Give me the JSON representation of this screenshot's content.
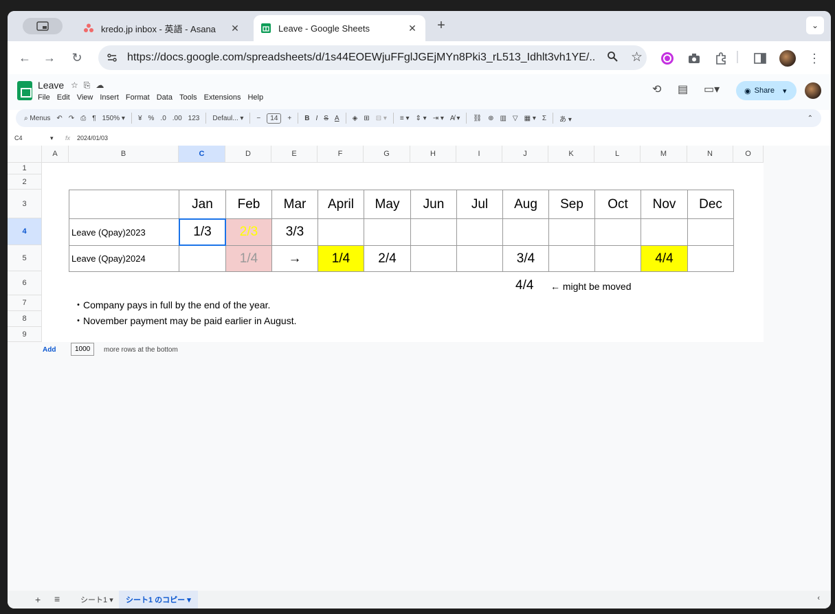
{
  "browser": {
    "tabs": [
      {
        "label": "kredo.jp inbox - 英語 - Asana",
        "close": "✕"
      },
      {
        "label": "Leave - Google Sheets",
        "close": "✕"
      }
    ],
    "new_tab": "+",
    "tab_menu": "⌄",
    "url": "https://docs.google.com/spreadsheets/d/1s44EOEWjuFFglJGEjMYn8Pki3_rL513_Idhlt3vh1YE/..."
  },
  "sheets": {
    "title": "Leave",
    "menu": [
      "File",
      "Edit",
      "View",
      "Insert",
      "Format",
      "Data",
      "Tools",
      "Extensions",
      "Help"
    ],
    "share_label": "Share",
    "toolbar": {
      "menus": "Menus",
      "zoom": "150%",
      "currency": "¥",
      "percent": "%",
      "dec_minus": ".0",
      "dec_plus": ".00",
      "number": "123",
      "font": "Defaul...",
      "minus": "−",
      "font_size": "14",
      "plus": "+",
      "bold": "B",
      "italic": "I",
      "strike": "S",
      "text_color": "A",
      "sum": "Σ",
      "input": "あ"
    },
    "name_box": "C4",
    "fx": "fx",
    "formula": "2024/01/03"
  },
  "grid": {
    "columns": [
      "A",
      "B",
      "C",
      "D",
      "E",
      "F",
      "G",
      "H",
      "I",
      "J",
      "K",
      "L",
      "M",
      "N",
      "O"
    ],
    "rows": [
      "1",
      "2",
      "3",
      "4",
      "5",
      "6",
      "7",
      "8",
      "9"
    ],
    "months": [
      "Jan",
      "Feb",
      "Mar",
      "April",
      "May",
      "Jun",
      "Jul",
      "Aug",
      "Sep",
      "Oct",
      "Nov",
      "Dec"
    ],
    "row4_label": "Leave (Qpay)2023",
    "row4": [
      "1/3",
      "2/3",
      "3/3",
      "",
      "",
      "",
      "",
      "",
      "",
      "",
      "",
      ""
    ],
    "row5_label": "Leave (Qpay)2024",
    "row5": [
      "",
      "1/4",
      "→",
      "1/4",
      "2/4",
      "",
      "",
      "3/4",
      "",
      "",
      "4/4",
      ""
    ],
    "row6_value": "4/4",
    "row6_note": "← might be moved",
    "note1": "・Company pays in full by the end of the year.",
    "note2": "・November payment may be paid earlier in August.",
    "add_label": "Add",
    "add_count": "1000",
    "add_suffix": "more rows at the bottom",
    "colors": {
      "yellow": "#ffff00",
      "pink": "#f4cccc",
      "selected_border": "#1a73e8"
    }
  },
  "bottom": {
    "add_sheet": "+",
    "all_sheets": "≡",
    "sheet1": "シート1",
    "sheet2": "シート1 のコピー"
  }
}
